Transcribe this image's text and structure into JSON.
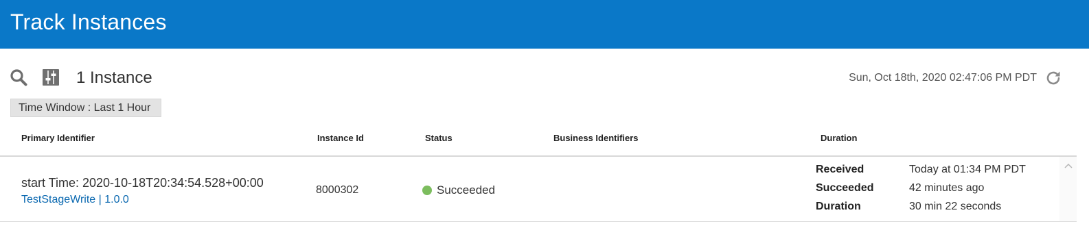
{
  "header": {
    "title": "Track Instances"
  },
  "toolbar": {
    "search_icon": "search-icon",
    "filter_icon": "filter-sliders-icon",
    "instance_count": "1 Instance",
    "timestamp": "Sun, Oct 18th, 2020 02:47:06 PM PDT",
    "refresh_icon": "refresh-icon",
    "time_window": "Time Window : Last 1 Hour"
  },
  "table": {
    "columns": [
      "Primary Identifier",
      "Instance Id",
      "Status",
      "Business Identifiers",
      "Duration"
    ],
    "rows": [
      {
        "primary_identifier": "start Time: 2020-10-18T20:34:54.528+00:00",
        "integration_link": "TestStageWrite | 1.0.0",
        "instance_id": "8000302",
        "status": "Succeeded",
        "business_identifiers": "",
        "duration": [
          {
            "label": "Received",
            "value": "Today at 01:34 PM PDT"
          },
          {
            "label": "Succeeded",
            "value": "42 minutes ago"
          },
          {
            "label": "Duration",
            "value": "30 min 22 seconds"
          }
        ]
      }
    ]
  },
  "colors": {
    "header_bg": "#0a78c8",
    "link": "#0a68b0",
    "status_success": "#7cbd5e"
  }
}
